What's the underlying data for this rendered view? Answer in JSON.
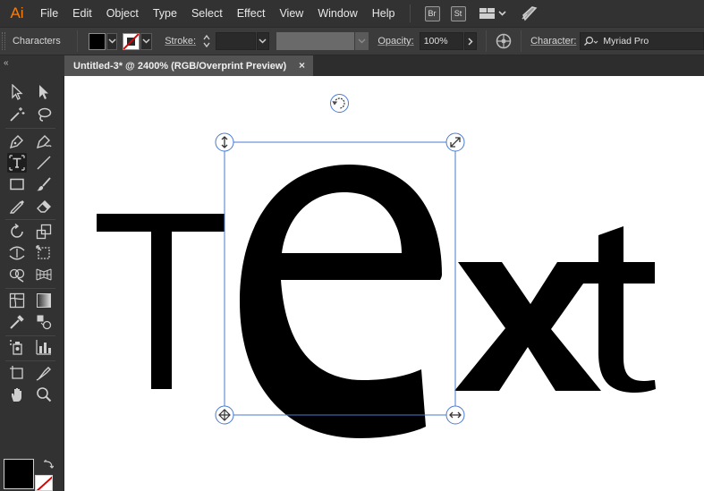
{
  "app": {
    "logo": "Ai",
    "menus": [
      "File",
      "Edit",
      "Object",
      "Type",
      "Select",
      "Effect",
      "View",
      "Window",
      "Help"
    ],
    "bridge_badge": "Br",
    "stock_badge": "St",
    "workspace_icon": "workspace-grid-icon",
    "gpu_icon": "rocket-icon"
  },
  "controlbar": {
    "selection_label": "Characters",
    "fill_color": "#000000",
    "stroke_label": "Stroke:",
    "stroke_weight": "",
    "opacity_label": "Opacity:",
    "opacity_value": "100%",
    "character_label": "Character:",
    "font_family": "Myriad Pro"
  },
  "document": {
    "tab_title": "Untitled-3* @ 2400% (RGB/Overprint Preview)",
    "close_glyph": "×"
  },
  "artwork": {
    "text": "Text",
    "text_color": "#000000",
    "selection_color": "#4a7bd0"
  },
  "toolbox": {
    "collapse_glyph": "«",
    "tools": [
      "selection-tool-icon",
      "direct-selection-tool-icon",
      "magic-wand-tool-icon",
      "lasso-tool-icon",
      "pen-tool-icon",
      "curvature-tool-icon",
      "type-tool-icon",
      "line-segment-tool-icon",
      "rectangle-tool-icon",
      "paintbrush-tool-icon",
      "shaper-tool-icon",
      "eraser-tool-icon",
      "rotate-tool-icon",
      "scale-tool-icon",
      "width-tool-icon",
      "free-transform-tool-icon",
      "shape-builder-tool-icon",
      "perspective-grid-tool-icon",
      "mesh-tool-icon",
      "gradient-tool-icon",
      "eyedropper-tool-icon",
      "blend-tool-icon",
      "symbol-sprayer-tool-icon",
      "column-graph-tool-icon",
      "artboard-tool-icon",
      "slice-tool-icon",
      "hand-tool-icon",
      "zoom-tool-icon"
    ],
    "active_tool": "type-tool-icon",
    "fill_swatch_color": "#000000"
  }
}
